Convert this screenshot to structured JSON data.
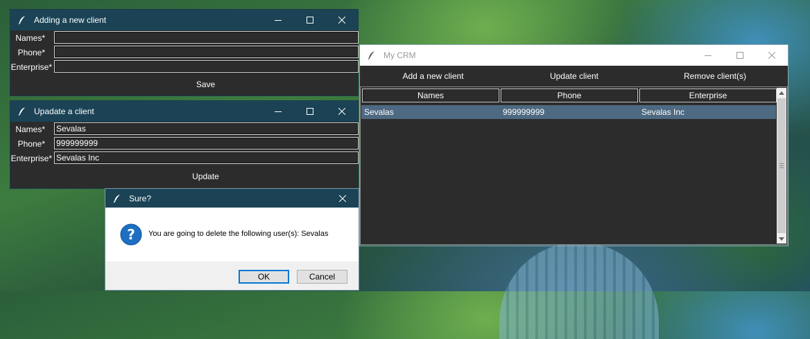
{
  "add_window": {
    "title": "Adding a new client",
    "fields": [
      {
        "label": "Names*",
        "value": ""
      },
      {
        "label": "Phone*",
        "value": ""
      },
      {
        "label": "Enterprise*",
        "value": ""
      }
    ],
    "submit_label": "Save"
  },
  "update_window": {
    "title": "Upadate a client",
    "fields": [
      {
        "label": "Names*",
        "value": "Sevalas"
      },
      {
        "label": "Phone*",
        "value": "999999999"
      },
      {
        "label": "Enterprise*",
        "value": "Sevalas Inc"
      }
    ],
    "submit_label": "Update"
  },
  "confirm_dialog": {
    "title": "Sure?",
    "message": "You are going to delete the following user(s): Sevalas",
    "ok_label": "OK",
    "cancel_label": "Cancel",
    "icon": "question-icon"
  },
  "crm_window": {
    "title": "My CRM",
    "toolbar": {
      "add_label": "Add a new client",
      "update_label": "Update client",
      "remove_label": "Remove client(s)"
    },
    "columns": [
      "Names",
      "Phone",
      "Enterprise"
    ],
    "rows": [
      {
        "name": "Sevalas",
        "phone": "999999999",
        "enterprise": "Sevalas Inc",
        "selected": true
      }
    ]
  },
  "colors": {
    "titlebar_active": "#1b4355",
    "window_bg": "#2c2c2c",
    "row_selected": "#4e6a82",
    "dialog_bg": "#ffffff",
    "accent": "#0078d7"
  },
  "icons": {
    "app": "feather-icon",
    "minimize": "minimize-icon",
    "maximize": "maximize-icon",
    "close": "close-icon"
  }
}
